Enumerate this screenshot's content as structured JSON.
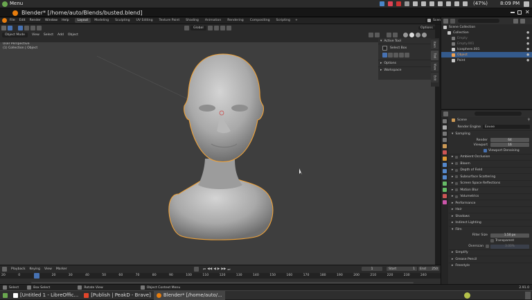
{
  "system": {
    "menu_label": "Menu",
    "battery": "(47%)",
    "time": "8:09 PM"
  },
  "window": {
    "title": "Blender* [/home/auto/Blends/busted.blend]"
  },
  "menubar": {
    "menus": [
      "File",
      "Edit",
      "Render",
      "Window",
      "Help"
    ],
    "workspaces": [
      "Layout",
      "Modeling",
      "Sculpting",
      "UV Editing",
      "Texture Paint",
      "Shading",
      "Animation",
      "Rendering",
      "Compositing",
      "Scripting"
    ],
    "active_workspace": 0,
    "scene": "Scene",
    "view_layer": "View Layer"
  },
  "viewport_header": {
    "mode": "Object Mode",
    "menus": [
      "View",
      "Select",
      "Add",
      "Object"
    ],
    "orientation": "Global",
    "options": "Options"
  },
  "viewport": {
    "view_name": "User Perspective",
    "collection_info": "(1) Collection | Object"
  },
  "npanel": {
    "active_tool": "Active Tool",
    "select_box": "Select Box",
    "options": "Options",
    "workspace": "Workspace",
    "tabs": [
      "Item",
      "Tool",
      "View",
      "Edit"
    ]
  },
  "outliner": {
    "items": [
      {
        "label": "Scene Collection",
        "indent": 0,
        "selected": false,
        "color": "#c8c8c8"
      },
      {
        "label": "Collection",
        "indent": 1,
        "selected": false,
        "color": "#c8c8c8"
      },
      {
        "label": "Empty",
        "indent": 2,
        "selected": false,
        "color": "#7a7a7a"
      },
      {
        "label": "Empty.001",
        "indent": 2,
        "selected": false,
        "color": "#7a7a7a"
      },
      {
        "label": "Icosphere.001",
        "indent": 2,
        "selected": false,
        "color": "#c8c8c8"
      },
      {
        "label": "Object",
        "indent": 2,
        "selected": true,
        "color": "#f0a050"
      },
      {
        "label": "Point",
        "indent": 2,
        "selected": false,
        "color": "#c8c8c8"
      }
    ]
  },
  "properties": {
    "scene": "Scene",
    "render_engine_label": "Render Engine",
    "render_engine": "Eevee",
    "sampling": "Sampling",
    "render_label": "Render",
    "render_samples": "64",
    "viewport_label": "Viewport",
    "viewport_samples": "16",
    "viewport_denoising": "Viewport Denoising",
    "sections": [
      "Ambient Occlusion",
      "Bloom",
      "Depth of Field",
      "Subsurface Scattering",
      "Screen Space Reflections",
      "Motion Blur",
      "Volumetrics",
      "Performance",
      "Hair",
      "Shadows",
      "Indirect Lighting"
    ],
    "film": "Film",
    "filter_size_label": "Filter Size",
    "filter_size": "1.50 px",
    "transparent": "Transparent",
    "overscan": "Overscan",
    "overscan_value": "3.00%",
    "bottom_sections": [
      "Simplify",
      "Grease Pencil",
      "Freestyle"
    ]
  },
  "timeline": {
    "menus": [
      "Playback",
      "Keying",
      "View",
      "Marker"
    ],
    "current_frame": "1",
    "start_label": "Start",
    "start": "1",
    "end_label": "End",
    "end": "250",
    "ticks": [
      "20",
      "0",
      "10",
      "20",
      "30",
      "40",
      "50",
      "60",
      "70",
      "80",
      "90",
      "100",
      "110",
      "120",
      "130",
      "140",
      "150",
      "160",
      "170",
      "180",
      "190",
      "200",
      "210",
      "220",
      "230",
      "240"
    ]
  },
  "statusbar": {
    "select": "Select",
    "box_select": "Box Select",
    "rotate_view": "Rotate View",
    "context_menu": "Object Context Menu",
    "version": "2.91.0"
  },
  "taskbar": {
    "tasks": [
      "[Untitled 1 - LibreOffic...",
      "[Publish | PeakD - Brave]",
      "Blender* [/home/auto/..."
    ]
  },
  "colors": {
    "accent": "#4772b3",
    "selection_outline": "#f0a33a",
    "viewport_bg": "#3e3e3e"
  }
}
